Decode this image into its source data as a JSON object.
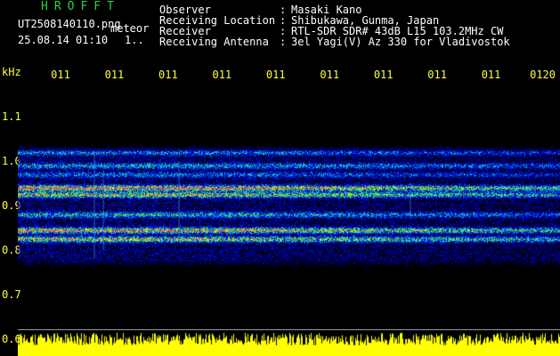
{
  "header": {
    "logo": "HROFFT",
    "filename": "UT2508140110.png",
    "tag": "meteor",
    "datetime": "25.08.14 01:10",
    "counter": "1..",
    "fields": [
      {
        "label": "Observer",
        "value": "Masaki Kano"
      },
      {
        "label": "Receiving Location",
        "value": "Shibukawa, Gunma, Japan"
      },
      {
        "label": "Receiver",
        "value": "RTL-SDR SDR# 43dB L15 103.2MHz CW"
      },
      {
        "label": "Receiving Antenna",
        "value": "3el Yagi(V) Az 330 for Vladivostok"
      }
    ],
    "separator": ":"
  },
  "axes": {
    "y_unit": "kHz",
    "y_ticks": [
      {
        "label": "1.1",
        "value": 1.1
      },
      {
        "label": "1.0",
        "value": 1.0
      },
      {
        "label": "0.9",
        "value": 0.9
      },
      {
        "label": "0.8",
        "value": 0.8
      },
      {
        "label": "0.7",
        "value": 0.7
      },
      {
        "label": "0.6",
        "value": 0.6
      }
    ],
    "x_ticks": [
      {
        "label": "011",
        "minute": 11
      },
      {
        "label": "011",
        "minute": 12
      },
      {
        "label": "011",
        "minute": 13
      },
      {
        "label": "011",
        "minute": 14
      },
      {
        "label": "011",
        "minute": 15
      },
      {
        "label": "011",
        "minute": 16
      },
      {
        "label": "011",
        "minute": 17
      },
      {
        "label": "011",
        "minute": 18
      },
      {
        "label": "011",
        "minute": 19
      },
      {
        "label": "0120",
        "minute": 20
      }
    ],
    "y_range": [
      0.6,
      1.15
    ]
  },
  "spectrogram": {
    "signal_band_khz": [
      0.76,
      1.04
    ],
    "bands_khz": [
      {
        "center": 0.94,
        "strength": 0.85
      },
      {
        "center": 0.925,
        "strength": 0.7
      },
      {
        "center": 0.88,
        "strength": 0.45
      },
      {
        "center": 0.845,
        "strength": 0.8
      },
      {
        "center": 0.825,
        "strength": 0.7
      },
      {
        "center": 0.99,
        "strength": 0.4
      },
      {
        "center": 1.02,
        "strength": 0.35
      },
      {
        "center": 0.97,
        "strength": 0.3
      }
    ]
  },
  "colors": {
    "background": "#000000",
    "label_yellow": "#ffff3c",
    "logo_green": "#2fcf4a",
    "power_yellow": "#ffff00"
  }
}
